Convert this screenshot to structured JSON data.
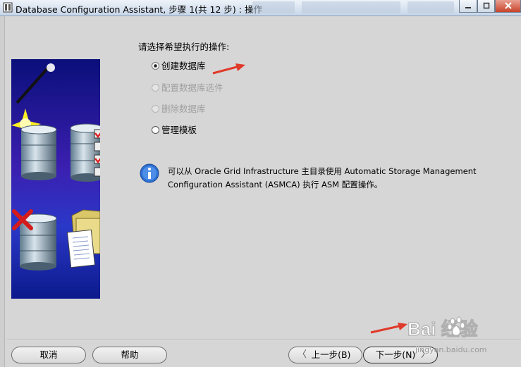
{
  "window": {
    "title": "Database Configuration Assistant, 步骤 1(共 12 步) : 操作"
  },
  "main": {
    "prompt": "请选择希望执行的操作:",
    "options": [
      {
        "label": "创建数据库",
        "selected": true,
        "enabled": true
      },
      {
        "label": "配置数据库选件",
        "selected": false,
        "enabled": false
      },
      {
        "label": "删除数据库",
        "selected": false,
        "enabled": false
      },
      {
        "label": "管理模板",
        "selected": false,
        "enabled": true
      }
    ],
    "info": "可以从 Oracle Grid Infrastructure 主目录使用 Automatic Storage Management Configuration Assistant (ASMCA) 执行 ASM 配置操作。"
  },
  "footer": {
    "cancel": "取消",
    "help": "帮助",
    "back": "上一步(B)",
    "next": "下一步(N)"
  },
  "watermark": {
    "brand": "Bai 经验",
    "url": "jingyan.baidu.com"
  },
  "colors": {
    "accent_arrow": "#e03a2a",
    "info_blue": "#2d6fd1"
  }
}
